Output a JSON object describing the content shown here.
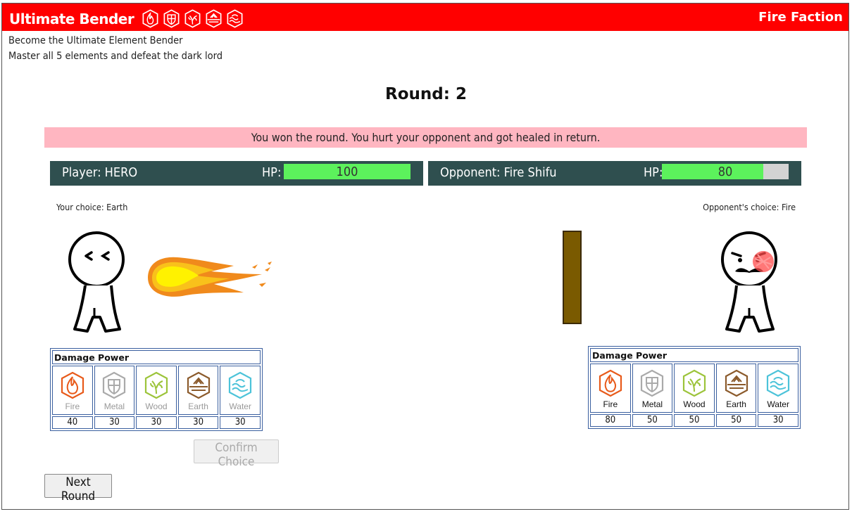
{
  "header": {
    "title": "Ultimate Bender",
    "faction": "Fire Faction",
    "icons": [
      "fire-icon",
      "metal-icon",
      "wood-icon",
      "earth-icon",
      "water-icon"
    ]
  },
  "intro": {
    "line1": "Become the Ultimate Element Bender",
    "line2": "Master all 5 elements and defeat the dark lord"
  },
  "round_label": "Round: 2",
  "banner": "You won the round. You hurt your opponent and got healed in return.",
  "player": {
    "name": "Player: HERO",
    "hp_label": "HP:",
    "hp": "100",
    "hp_fraction": 1.0,
    "choice": "Your choice: Earth"
  },
  "opponent": {
    "name": "Opponent: Fire Shifu",
    "hp_label": "HP:",
    "hp": "80",
    "hp_fraction": 0.8,
    "choice": "Opponent's choice: Fire"
  },
  "damage_title": "Damage Power",
  "elements": [
    "Fire",
    "Metal",
    "Wood",
    "Earth",
    "Water"
  ],
  "player_damage": [
    "40",
    "30",
    "30",
    "30",
    "30"
  ],
  "opponent_damage": [
    "80",
    "50",
    "50",
    "50",
    "30"
  ],
  "colors": {
    "fire": "#e85a1a",
    "metal": "#aaaaaa",
    "wood": "#9cc43a",
    "earth": "#8b5a2b",
    "water": "#4cc3d9"
  },
  "buttons": {
    "confirm": "Confirm Choice",
    "next": "Next Round"
  }
}
